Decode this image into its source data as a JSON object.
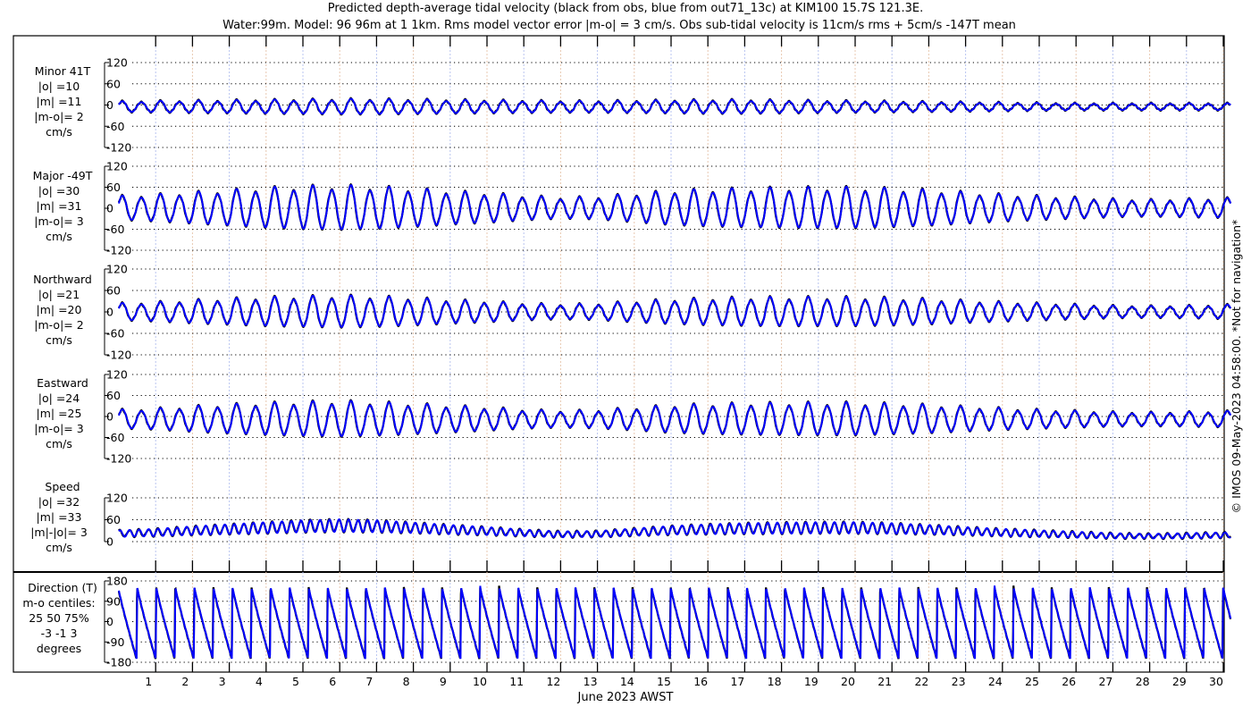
{
  "chart_data": {
    "type": "line",
    "title": "Predicted depth-average tidal velocity (black from obs, blue from out71_13c) at KIM100 15.7S 121.3E.",
    "subtitle": "Water:99m. Model: 96 96m at 1 1km. Rms model vector error |m-o| = 3 cm/s. Obs sub-tidal velocity is 11cm/s rms + 5cm/s -147T mean",
    "xlabel": "June 2023 AWST",
    "x_ticks": [
      "1",
      "2",
      "3",
      "4",
      "5",
      "6",
      "7",
      "8",
      "9",
      "10",
      "11",
      "12",
      "13",
      "14",
      "15",
      "16",
      "17",
      "18",
      "19",
      "20",
      "21",
      "22",
      "23",
      "24",
      "25",
      "26",
      "27",
      "28",
      "29",
      "30"
    ],
    "xlim_days": [
      0,
      30.2
    ],
    "tidal_period_hours": 12.42,
    "envelope_days": [
      0,
      1,
      2,
      3,
      4,
      5,
      6,
      7,
      8,
      9,
      10,
      11,
      12,
      13,
      14,
      15,
      16,
      17,
      18,
      19,
      20,
      21,
      22,
      23,
      24,
      25,
      26,
      27,
      28,
      29,
      30
    ],
    "watermark": "© IMOS 09-May-2023 04:58:00.  *Not for navigation*",
    "colors": {
      "obs": "#000000",
      "model": "#0000ff",
      "grid": "#000000",
      "vgrid": "#b8c4f0"
    },
    "panels": [
      {
        "key": "minor",
        "label": [
          "Minor 41T",
          "|o| =10",
          "|m| =11",
          "|m-o|= 2",
          "cm/s"
        ],
        "ylim": [
          -120,
          120
        ],
        "yticks": [
          "120",
          "60",
          "0",
          "-60",
          "-120"
        ],
        "ytick_values": [
          120,
          60,
          0,
          -60,
          -120
        ],
        "amplitude": [
          14,
          15,
          16,
          17,
          18,
          19,
          20,
          20,
          19,
          18,
          17,
          16,
          15,
          15,
          16,
          17,
          18,
          18,
          17,
          16,
          15,
          14,
          13,
          12,
          11,
          10,
          9,
          9,
          9,
          9,
          9
        ],
        "mean": -5
      },
      {
        "key": "major",
        "label": [
          "Major -49T",
          "|o| =30",
          "|m| =31",
          "|m-o|= 3",
          "cm/s"
        ],
        "ylim": [
          -120,
          120
        ],
        "yticks": [
          "120",
          "60",
          "0",
          "-60",
          "-120"
        ],
        "ytick_values": [
          120,
          60,
          0,
          -60,
          -120
        ],
        "amplitude": [
          32,
          36,
          42,
          48,
          54,
          58,
          60,
          57,
          52,
          45,
          40,
          33,
          28,
          30,
          38,
          46,
          50,
          52,
          54,
          55,
          55,
          52,
          48,
          42,
          36,
          32,
          28,
          24,
          22,
          24,
          26
        ],
        "mean": 0
      },
      {
        "key": "north",
        "label": [
          "Northward",
          "|o| =21",
          "|m| =20",
          "|m-o|= 2",
          "cm/s"
        ],
        "ylim": [
          -120,
          120
        ],
        "yticks": [
          "120",
          "60",
          "0",
          "-60",
          "-120"
        ],
        "ytick_values": [
          120,
          60,
          0,
          -60,
          -120
        ],
        "amplitude": [
          22,
          25,
          30,
          34,
          38,
          40,
          42,
          40,
          36,
          31,
          27,
          22,
          19,
          21,
          27,
          32,
          35,
          37,
          38,
          38,
          38,
          36,
          33,
          29,
          25,
          22,
          19,
          16,
          15,
          16,
          18
        ],
        "mean": 0
      },
      {
        "key": "east",
        "label": [
          "Eastward",
          "|o| =24",
          "|m| =25",
          "|m-o|= 3",
          "cm/s"
        ],
        "ylim": [
          -120,
          120
        ],
        "yticks": [
          "120",
          "60",
          "0",
          "-60",
          "-120"
        ],
        "ytick_values": [
          120,
          60,
          0,
          -60,
          -120
        ],
        "amplitude": [
          25,
          28,
          34,
          39,
          43,
          46,
          48,
          45,
          41,
          36,
          31,
          25,
          22,
          24,
          30,
          37,
          40,
          42,
          43,
          44,
          44,
          41,
          38,
          33,
          29,
          25,
          22,
          19,
          18,
          19,
          21
        ],
        "mean": -8
      },
      {
        "key": "speed",
        "label": [
          "Speed",
          "|o| =32",
          "|m| =33",
          "|m|-|o|= 3",
          "cm/s"
        ],
        "ylim": [
          0,
          120
        ],
        "yticks": [
          "120",
          "60",
          "0"
        ],
        "ytick_values": [
          120,
          60,
          0
        ],
        "amplitude": [
          10,
          11,
          13,
          15,
          17,
          18,
          19,
          18,
          16,
          14,
          12,
          10,
          9,
          9,
          11,
          13,
          15,
          16,
          17,
          17,
          17,
          16,
          14,
          12,
          11,
          10,
          9,
          8,
          7,
          8,
          8
        ],
        "mean_curve": [
          22,
          25,
          30,
          34,
          38,
          42,
          44,
          42,
          38,
          33,
          29,
          24,
          20,
          21,
          26,
          31,
          34,
          36,
          37,
          38,
          38,
          36,
          33,
          29,
          25,
          22,
          19,
          16,
          15,
          16,
          18
        ]
      },
      {
        "key": "direction",
        "label": [
          "Direction (T)",
          "m-o centiles:",
          "25  50  75%",
          "-3 -1  3",
          "degrees"
        ],
        "ylim": [
          -180,
          180
        ],
        "yticks": [
          "180",
          "90",
          "0",
          "-90",
          "-180"
        ],
        "ytick_values": [
          180,
          90,
          0,
          -90,
          -180
        ]
      }
    ]
  }
}
